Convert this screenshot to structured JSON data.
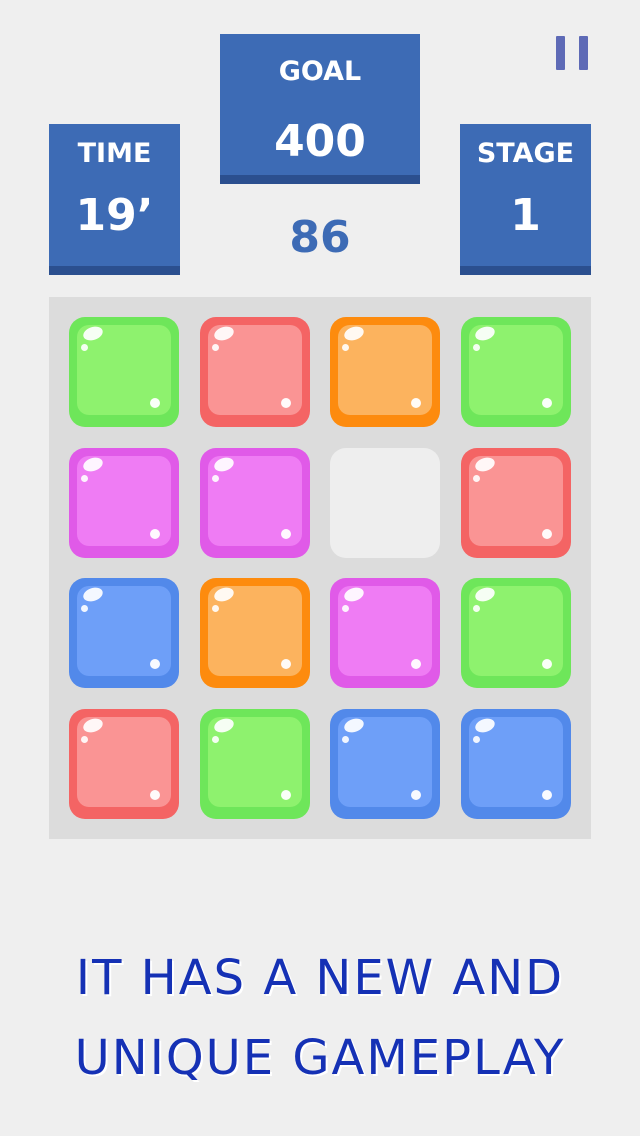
{
  "hud": {
    "goal": {
      "label": "GOAL",
      "value": "400"
    },
    "time": {
      "label": "TIME",
      "value": "19’"
    },
    "stage": {
      "label": "STAGE",
      "value": "1"
    },
    "score": "86"
  },
  "colors": {
    "panel": "#3d6bb5",
    "panel_shadow": "#2b4f8f",
    "score_text": "#3d6bb5",
    "pause_icon": "#5e6ab6",
    "tagline": "#1531b5",
    "board_bg": "#dcdcdc",
    "page_bg": "#efefef"
  },
  "tile_colors": {
    "green": {
      "outer": "#6ee65a",
      "inner": "#8ef26e"
    },
    "red": {
      "outer": "#f46464",
      "inner": "#fa9494"
    },
    "orange": {
      "outer": "#fd8b0e",
      "inner": "#fcb35e"
    },
    "magenta": {
      "outer": "#e05ae8",
      "inner": "#ef7cf4"
    },
    "blue": {
      "outer": "#5289ea",
      "inner": "#6e9ff8"
    }
  },
  "board": {
    "rows": 4,
    "cols": 4,
    "cells": [
      [
        "green",
        "red",
        "orange",
        "green"
      ],
      [
        "magenta",
        "magenta",
        "empty",
        "red"
      ],
      [
        "blue",
        "orange",
        "magenta",
        "green"
      ],
      [
        "red",
        "green",
        "blue",
        "blue"
      ]
    ]
  },
  "pause": {
    "icon": "pause-icon"
  },
  "tagline": {
    "line1": "IT HAS A NEW AND",
    "line2": "UNIQUE GAMEPLAY"
  }
}
